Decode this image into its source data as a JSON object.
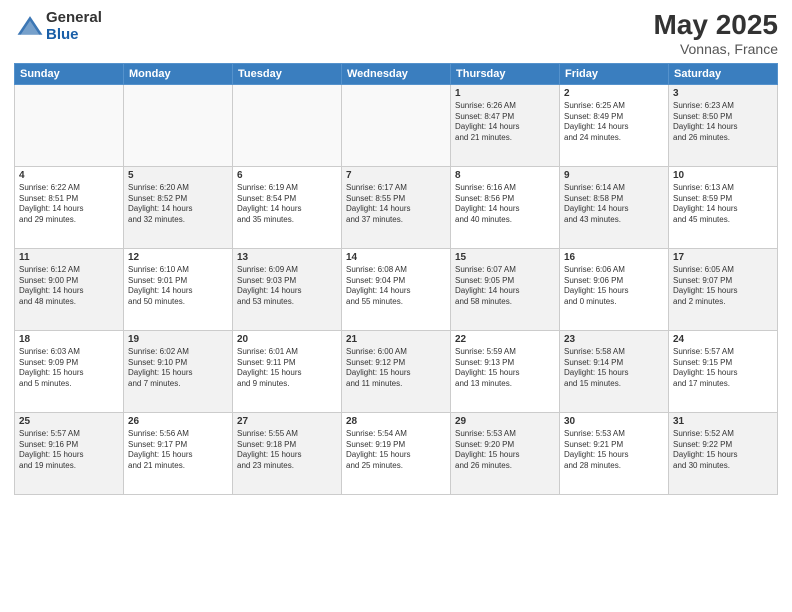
{
  "header": {
    "logo_general": "General",
    "logo_blue": "Blue",
    "month": "May 2025",
    "location": "Vonnas, France"
  },
  "weekdays": [
    "Sunday",
    "Monday",
    "Tuesday",
    "Wednesday",
    "Thursday",
    "Friday",
    "Saturday"
  ],
  "weeks": [
    [
      {
        "day": "",
        "info": ""
      },
      {
        "day": "",
        "info": ""
      },
      {
        "day": "",
        "info": ""
      },
      {
        "day": "",
        "info": ""
      },
      {
        "day": "1",
        "info": "Sunrise: 6:26 AM\nSunset: 8:47 PM\nDaylight: 14 hours\nand 21 minutes."
      },
      {
        "day": "2",
        "info": "Sunrise: 6:25 AM\nSunset: 8:49 PM\nDaylight: 14 hours\nand 24 minutes."
      },
      {
        "day": "3",
        "info": "Sunrise: 6:23 AM\nSunset: 8:50 PM\nDaylight: 14 hours\nand 26 minutes."
      }
    ],
    [
      {
        "day": "4",
        "info": "Sunrise: 6:22 AM\nSunset: 8:51 PM\nDaylight: 14 hours\nand 29 minutes."
      },
      {
        "day": "5",
        "info": "Sunrise: 6:20 AM\nSunset: 8:52 PM\nDaylight: 14 hours\nand 32 minutes."
      },
      {
        "day": "6",
        "info": "Sunrise: 6:19 AM\nSunset: 8:54 PM\nDaylight: 14 hours\nand 35 minutes."
      },
      {
        "day": "7",
        "info": "Sunrise: 6:17 AM\nSunset: 8:55 PM\nDaylight: 14 hours\nand 37 minutes."
      },
      {
        "day": "8",
        "info": "Sunrise: 6:16 AM\nSunset: 8:56 PM\nDaylight: 14 hours\nand 40 minutes."
      },
      {
        "day": "9",
        "info": "Sunrise: 6:14 AM\nSunset: 8:58 PM\nDaylight: 14 hours\nand 43 minutes."
      },
      {
        "day": "10",
        "info": "Sunrise: 6:13 AM\nSunset: 8:59 PM\nDaylight: 14 hours\nand 45 minutes."
      }
    ],
    [
      {
        "day": "11",
        "info": "Sunrise: 6:12 AM\nSunset: 9:00 PM\nDaylight: 14 hours\nand 48 minutes."
      },
      {
        "day": "12",
        "info": "Sunrise: 6:10 AM\nSunset: 9:01 PM\nDaylight: 14 hours\nand 50 minutes."
      },
      {
        "day": "13",
        "info": "Sunrise: 6:09 AM\nSunset: 9:03 PM\nDaylight: 14 hours\nand 53 minutes."
      },
      {
        "day": "14",
        "info": "Sunrise: 6:08 AM\nSunset: 9:04 PM\nDaylight: 14 hours\nand 55 minutes."
      },
      {
        "day": "15",
        "info": "Sunrise: 6:07 AM\nSunset: 9:05 PM\nDaylight: 14 hours\nand 58 minutes."
      },
      {
        "day": "16",
        "info": "Sunrise: 6:06 AM\nSunset: 9:06 PM\nDaylight: 15 hours\nand 0 minutes."
      },
      {
        "day": "17",
        "info": "Sunrise: 6:05 AM\nSunset: 9:07 PM\nDaylight: 15 hours\nand 2 minutes."
      }
    ],
    [
      {
        "day": "18",
        "info": "Sunrise: 6:03 AM\nSunset: 9:09 PM\nDaylight: 15 hours\nand 5 minutes."
      },
      {
        "day": "19",
        "info": "Sunrise: 6:02 AM\nSunset: 9:10 PM\nDaylight: 15 hours\nand 7 minutes."
      },
      {
        "day": "20",
        "info": "Sunrise: 6:01 AM\nSunset: 9:11 PM\nDaylight: 15 hours\nand 9 minutes."
      },
      {
        "day": "21",
        "info": "Sunrise: 6:00 AM\nSunset: 9:12 PM\nDaylight: 15 hours\nand 11 minutes."
      },
      {
        "day": "22",
        "info": "Sunrise: 5:59 AM\nSunset: 9:13 PM\nDaylight: 15 hours\nand 13 minutes."
      },
      {
        "day": "23",
        "info": "Sunrise: 5:58 AM\nSunset: 9:14 PM\nDaylight: 15 hours\nand 15 minutes."
      },
      {
        "day": "24",
        "info": "Sunrise: 5:57 AM\nSunset: 9:15 PM\nDaylight: 15 hours\nand 17 minutes."
      }
    ],
    [
      {
        "day": "25",
        "info": "Sunrise: 5:57 AM\nSunset: 9:16 PM\nDaylight: 15 hours\nand 19 minutes."
      },
      {
        "day": "26",
        "info": "Sunrise: 5:56 AM\nSunset: 9:17 PM\nDaylight: 15 hours\nand 21 minutes."
      },
      {
        "day": "27",
        "info": "Sunrise: 5:55 AM\nSunset: 9:18 PM\nDaylight: 15 hours\nand 23 minutes."
      },
      {
        "day": "28",
        "info": "Sunrise: 5:54 AM\nSunset: 9:19 PM\nDaylight: 15 hours\nand 25 minutes."
      },
      {
        "day": "29",
        "info": "Sunrise: 5:53 AM\nSunset: 9:20 PM\nDaylight: 15 hours\nand 26 minutes."
      },
      {
        "day": "30",
        "info": "Sunrise: 5:53 AM\nSunset: 9:21 PM\nDaylight: 15 hours\nand 28 minutes."
      },
      {
        "day": "31",
        "info": "Sunrise: 5:52 AM\nSunset: 9:22 PM\nDaylight: 15 hours\nand 30 minutes."
      }
    ]
  ]
}
